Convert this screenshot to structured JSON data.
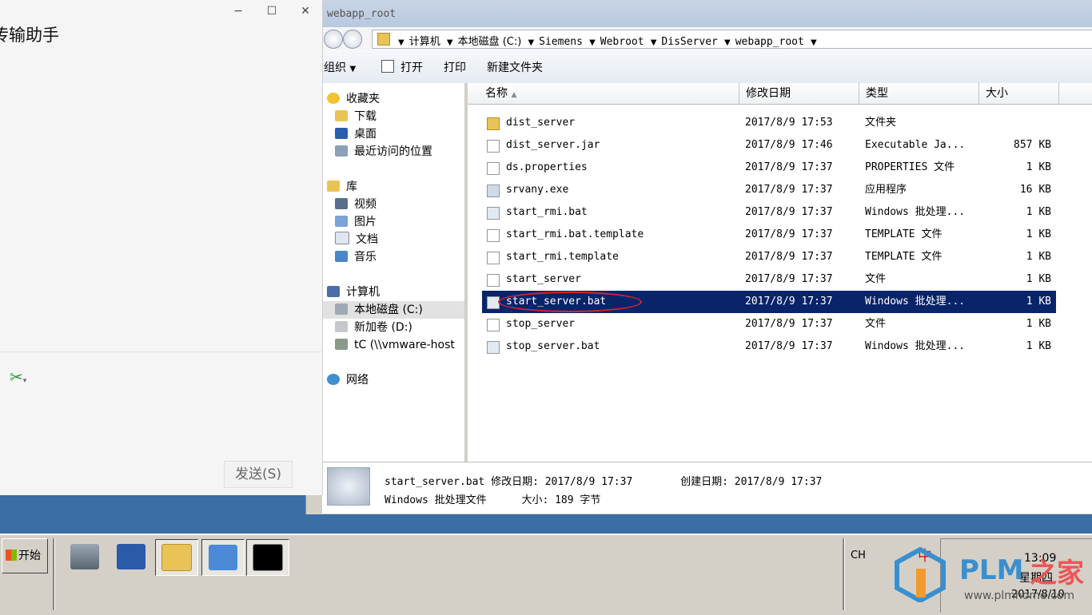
{
  "chat": {
    "title": "传输助手",
    "minimize": "−",
    "maximize": "☐",
    "close": "✕",
    "scissors_icon": "✂",
    "send_label": "发送(S)"
  },
  "explorer": {
    "title": "webapp_root",
    "breadcrumbs": [
      "计算机",
      "本地磁盘 (C:)",
      "Siemens",
      "Webroot",
      "DisServer",
      "webapp_root"
    ],
    "toolbar": {
      "organize": "组织",
      "open": "打开",
      "print": "打印",
      "new_folder": "新建文件夹"
    },
    "nav": {
      "favorites": "收藏夹",
      "downloads": "下载",
      "desktop": "桌面",
      "recent": "最近访问的位置",
      "libraries": "库",
      "videos": "视频",
      "pictures": "图片",
      "documents": "文档",
      "music": "音乐",
      "computer": "计算机",
      "drive_c": "本地磁盘 (C:)",
      "drive_d": "新加卷 (D:)",
      "tc": "tC (\\\\vmware-host",
      "network": "网络"
    },
    "columns": {
      "name": "名称",
      "date": "修改日期",
      "type": "类型",
      "size": "大小"
    },
    "files": [
      {
        "name": "dist_server",
        "date": "2017/8/9 17:53",
        "type": "文件夹",
        "size": ""
      },
      {
        "name": "dist_server.jar",
        "date": "2017/8/9 17:46",
        "type": "Executable Ja...",
        "size": "857 KB"
      },
      {
        "name": "ds.properties",
        "date": "2017/8/9 17:37",
        "type": "PROPERTIES 文件",
        "size": "1 KB"
      },
      {
        "name": "srvany.exe",
        "date": "2017/8/9 17:37",
        "type": "应用程序",
        "size": "16 KB"
      },
      {
        "name": "start_rmi.bat",
        "date": "2017/8/9 17:37",
        "type": "Windows 批处理...",
        "size": "1 KB"
      },
      {
        "name": "start_rmi.bat.template",
        "date": "2017/8/9 17:37",
        "type": "TEMPLATE 文件",
        "size": "1 KB"
      },
      {
        "name": "start_rmi.template",
        "date": "2017/8/9 17:37",
        "type": "TEMPLATE 文件",
        "size": "1 KB"
      },
      {
        "name": "start_server",
        "date": "2017/8/9 17:37",
        "type": "文件",
        "size": "1 KB"
      },
      {
        "name": "start_server.bat",
        "date": "2017/8/9 17:37",
        "type": "Windows 批处理...",
        "size": "1 KB"
      },
      {
        "name": "stop_server",
        "date": "2017/8/9 17:37",
        "type": "文件",
        "size": "1 KB"
      },
      {
        "name": "stop_server.bat",
        "date": "2017/8/9 17:37",
        "type": "Windows 批处理...",
        "size": "1 KB"
      }
    ],
    "details": {
      "name": "start_server.bat",
      "modified": "修改日期: 2017/8/9 17:37",
      "created": "创建日期: 2017/8/9 17:37",
      "kind": "Windows 批处理文件",
      "size": "大小: 189 字节"
    }
  },
  "taskbar": {
    "start": "开始",
    "lang": "CH",
    "ime": "中",
    "time": "13:09",
    "weekday": "星期四",
    "date": "2017/8/10"
  },
  "watermark": {
    "brand": "PLM",
    "brand_zh": "之家",
    "url": "www.plmhome.com"
  }
}
